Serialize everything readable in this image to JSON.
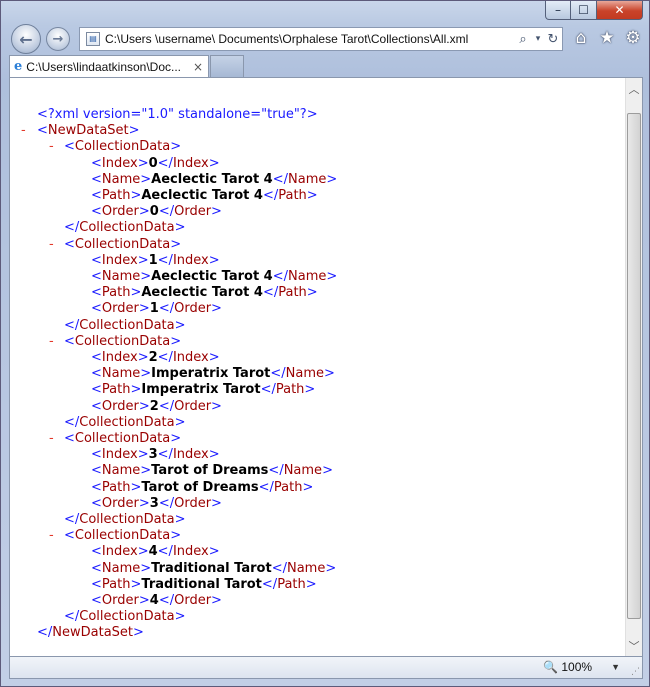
{
  "window": {
    "minimize_glyph": "–",
    "maximize_glyph": "☐",
    "close_glyph": "✕"
  },
  "nav": {
    "back_glyph": "←",
    "forward_glyph": "→",
    "address": "C:\\Users  \\username\\  Documents\\Orphalese Tarot\\Collections\\All.xml",
    "search_glyph": "⌕",
    "dropdown_glyph": "▾",
    "refresh_glyph": "↻",
    "home_glyph": "⌂",
    "favorites_glyph": "★",
    "tools_glyph": "⚙"
  },
  "tab": {
    "icon_glyph": "e",
    "title": "C:\\Users\\lindaatkinson\\Doc...",
    "close_glyph": "×"
  },
  "xml": {
    "declaration": "<?xml version=\"1.0\" standalone=\"true\"?>",
    "collapse": "-",
    "root_tag": "NewDataSet",
    "item_tag": "CollectionData",
    "fields": [
      "Index",
      "Name",
      "Path",
      "Order"
    ],
    "items": [
      {
        "Index": "0",
        "Name": "Aeclectic Tarot 4",
        "Path": "Aeclectic Tarot 4",
        "Order": "0"
      },
      {
        "Index": "1",
        "Name": "Aeclectic Tarot 4",
        "Path": "Aeclectic Tarot 4",
        "Order": "1"
      },
      {
        "Index": "2",
        "Name": "Imperatrix Tarot",
        "Path": "Imperatrix Tarot",
        "Order": "2"
      },
      {
        "Index": "3",
        "Name": "Tarot of Dreams",
        "Path": "Tarot of Dreams",
        "Order": "3"
      },
      {
        "Index": "4",
        "Name": "Traditional Tarot",
        "Path": "Traditional Tarot",
        "Order": "4"
      }
    ]
  },
  "scrollbar": {
    "up_glyph": "︿",
    "down_glyph": "﹀"
  },
  "status": {
    "zoom_icon_glyph": "🔍",
    "zoom": "100%",
    "zoom_dropdown_glyph": "▼",
    "grip_glyph": "⋰"
  }
}
